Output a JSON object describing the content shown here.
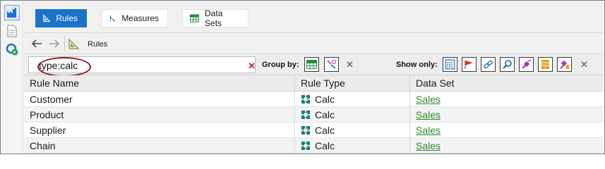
{
  "toolbar": {
    "tabs": [
      {
        "label": "Rules",
        "icon": "rules-icon",
        "active": true
      },
      {
        "label": "Measures",
        "icon": "measures-icon",
        "active": false
      },
      {
        "label": "Data Sets",
        "icon": "data-sets-icon",
        "active": false
      }
    ]
  },
  "breadcrumb": {
    "current": "Rules"
  },
  "filter": {
    "search_value": "type:calc",
    "group_by_label": "Group by:",
    "show_only_label": "Show only:"
  },
  "grid": {
    "columns": [
      "Rule Name",
      "Rule Type",
      "Data Set"
    ],
    "rows": [
      {
        "name": "Customer",
        "type": "Calc",
        "dataset": "Sales"
      },
      {
        "name": "Product",
        "type": "Calc",
        "dataset": "Sales"
      },
      {
        "name": "Supplier",
        "type": "Calc",
        "dataset": "Sales"
      },
      {
        "name": "Chain",
        "type": "Calc",
        "dataset": "Sales"
      }
    ]
  },
  "colors": {
    "accent": "#1a73c8",
    "link": "#2a8a2a",
    "clear": "#c0202a",
    "highlight_oval": "#8b1a1a"
  }
}
